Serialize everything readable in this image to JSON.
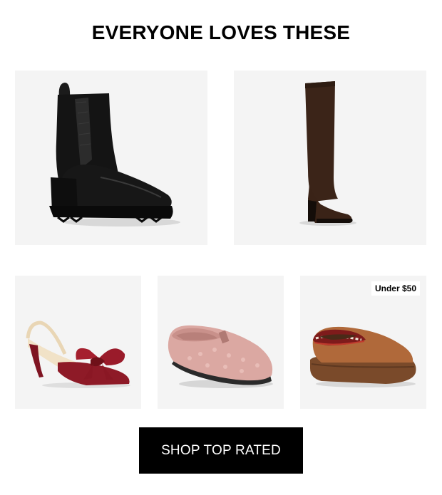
{
  "section": {
    "title": "EVERYONE LOVES THESE"
  },
  "products": [
    {
      "icon": "black-chelsea-boot-image"
    },
    {
      "icon": "brown-knee-high-boot-image"
    },
    {
      "icon": "red-bow-slingback-heel-image"
    },
    {
      "icon": "pink-sherpa-clog-slipper-image"
    },
    {
      "icon": "chestnut-platform-slipper-image",
      "badge": "Under $50"
    }
  ],
  "cta": {
    "label": "SHOP TOP RATED"
  },
  "colors": {
    "card_bg": "#f4f4f4",
    "cta_bg": "#000000",
    "cta_text": "#ffffff"
  }
}
